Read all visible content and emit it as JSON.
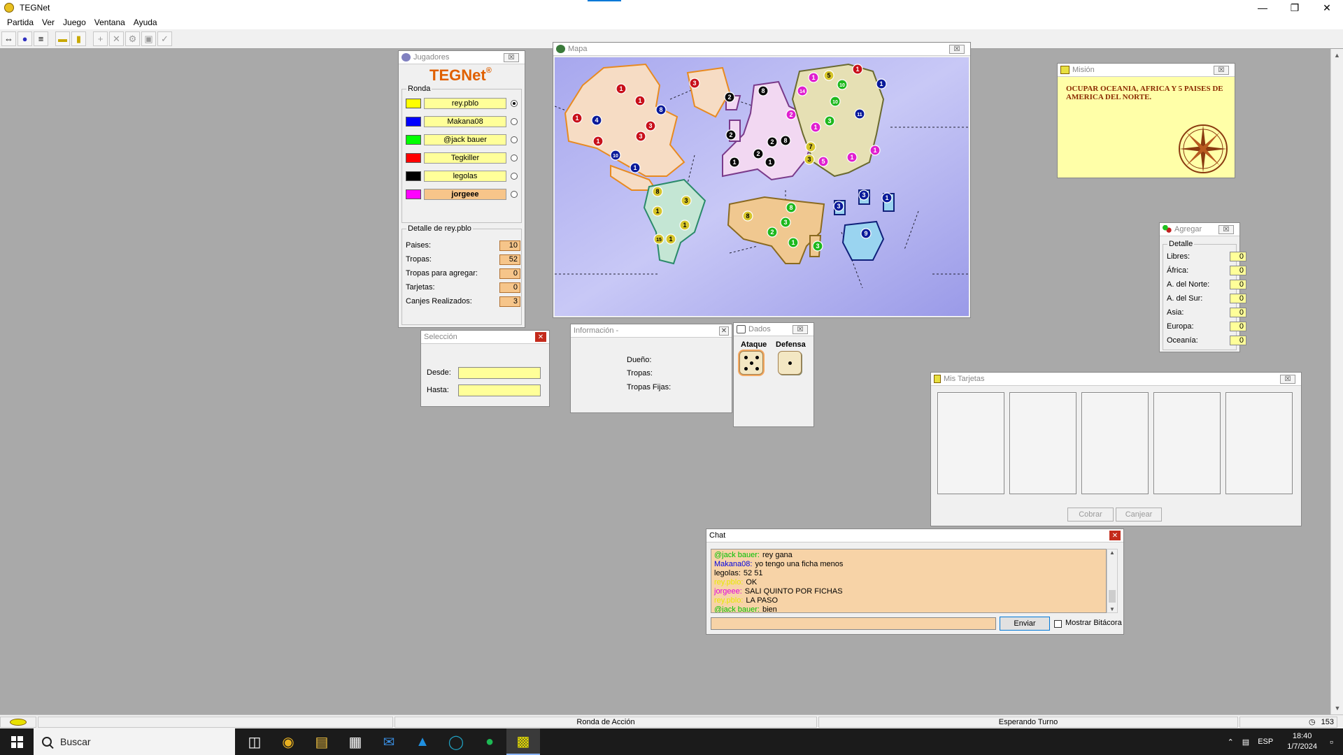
{
  "window": {
    "title": "TEGNet"
  },
  "menu": [
    "Partida",
    "Ver",
    "Juego",
    "Ventana",
    "Ayuda"
  ],
  "toolbar_icons": [
    "connect-icon",
    "server-icon",
    "list-icon",
    "card-icon",
    "note-icon",
    "add-icon",
    "remove-icon",
    "gear-icon",
    "copy-icon",
    "check-icon"
  ],
  "players_window": {
    "title": "Jugadores",
    "logo": "TEGNet",
    "round_label": "Ronda",
    "players": [
      {
        "name": "rey.pblo",
        "color": "#ffff00",
        "selected": true
      },
      {
        "name": "Makana08",
        "color": "#0000ff",
        "selected": false
      },
      {
        "name": "@jack bauer",
        "color": "#00ff00",
        "selected": false
      },
      {
        "name": "Tegkiller",
        "color": "#ff0000",
        "selected": false
      },
      {
        "name": "legolas",
        "color": "#000000",
        "selected": false
      },
      {
        "name": "jorgeee",
        "color": "#ff00ff",
        "selected": false
      }
    ],
    "detail_label": "Detalle de rey.pblo",
    "details": [
      {
        "label": "Paises:",
        "value": "10"
      },
      {
        "label": "Tropas:",
        "value": "52"
      },
      {
        "label": "Tropas para agregar:",
        "value": "0"
      },
      {
        "label": "Tarjetas:",
        "value": "0"
      },
      {
        "label": "Canjes Realizados:",
        "value": "3"
      }
    ]
  },
  "map_window": {
    "title": "Mapa",
    "colors": {
      "yellow": "#d6c52a",
      "blue": "#0a1a9a",
      "green": "#1db81d",
      "red": "#c8101a",
      "black": "#0a0a0a",
      "magenta": "#e020d0"
    },
    "armies": [
      {
        "n": "1",
        "c": "red"
      },
      {
        "n": "4",
        "c": "blue"
      },
      {
        "n": "1",
        "c": "red"
      },
      {
        "n": "3",
        "c": "red"
      },
      {
        "n": "8",
        "c": "blue"
      },
      {
        "n": "1",
        "c": "red"
      },
      {
        "n": "3",
        "c": "red"
      },
      {
        "n": "1",
        "c": "red"
      },
      {
        "n": "10",
        "c": "blue"
      },
      {
        "n": "1",
        "c": "blue"
      },
      {
        "n": "3",
        "c": "red"
      },
      {
        "n": "2",
        "c": "black"
      },
      {
        "n": "8",
        "c": "black"
      },
      {
        "n": "2",
        "c": "magenta"
      },
      {
        "n": "2",
        "c": "black"
      },
      {
        "n": "2",
        "c": "black"
      },
      {
        "n": "8",
        "c": "black"
      },
      {
        "n": "2",
        "c": "black"
      },
      {
        "n": "1",
        "c": "black"
      },
      {
        "n": "1",
        "c": "black"
      },
      {
        "n": "1",
        "c": "magenta"
      },
      {
        "n": "5",
        "c": "yellow"
      },
      {
        "n": "10",
        "c": "green"
      },
      {
        "n": "1",
        "c": "red"
      },
      {
        "n": "14",
        "c": "magenta"
      },
      {
        "n": "10",
        "c": "green"
      },
      {
        "n": "3",
        "c": "green"
      },
      {
        "n": "11",
        "c": "blue"
      },
      {
        "n": "1",
        "c": "blue"
      },
      {
        "n": "1",
        "c": "magenta"
      },
      {
        "n": "7",
        "c": "yellow"
      },
      {
        "n": "3",
        "c": "yellow"
      },
      {
        "n": "5",
        "c": "magenta"
      },
      {
        "n": "1",
        "c": "magenta"
      },
      {
        "n": "1",
        "c": "magenta"
      },
      {
        "n": "8",
        "c": "yellow"
      },
      {
        "n": "3",
        "c": "yellow"
      },
      {
        "n": "1",
        "c": "yellow"
      },
      {
        "n": "1",
        "c": "yellow"
      },
      {
        "n": "15",
        "c": "yellow"
      },
      {
        "n": "1",
        "c": "yellow"
      },
      {
        "n": "8",
        "c": "green"
      },
      {
        "n": "8",
        "c": "yellow"
      },
      {
        "n": "3",
        "c": "green"
      },
      {
        "n": "2",
        "c": "green"
      },
      {
        "n": "1",
        "c": "green"
      },
      {
        "n": "3",
        "c": "green"
      },
      {
        "n": "3",
        "c": "blue"
      },
      {
        "n": "3",
        "c": "blue"
      },
      {
        "n": "1",
        "c": "blue"
      },
      {
        "n": "9",
        "c": "blue"
      }
    ]
  },
  "mission_window": {
    "title": "Misión",
    "text": "OCUPAR OCEANIA, AFRICA Y 5 PAISES DE AMERICA DEL NORTE."
  },
  "add_window": {
    "title": "Agregar",
    "group": "Detalle",
    "rows": [
      {
        "label": "Libres:",
        "value": "0"
      },
      {
        "label": "África:",
        "value": "0"
      },
      {
        "label": "A. del Norte:",
        "value": "0"
      },
      {
        "label": "A. del Sur:",
        "value": "0"
      },
      {
        "label": "Asia:",
        "value": "0"
      },
      {
        "label": "Europa:",
        "value": "0"
      },
      {
        "label": "Oceanía:",
        "value": "0"
      }
    ]
  },
  "selection_window": {
    "title": "Selección",
    "from_label": "Desde:",
    "to_label": "Hasta:",
    "from_value": "",
    "to_value": ""
  },
  "info_window": {
    "title": "Información -",
    "owner_label": "Dueño:",
    "troops_label": "Tropas:",
    "fixed_label": "Tropas Fijas:"
  },
  "dice_window": {
    "title": "Dados",
    "attack_label": "Ataque",
    "defense_label": "Defensa",
    "attack_value": 5,
    "defense_value": 1
  },
  "cards_window": {
    "title": "Mis Tarjetas",
    "collect_label": "Cobrar",
    "exchange_label": "Canjear"
  },
  "chat_window": {
    "title": "Chat",
    "messages": [
      {
        "name": "@jack bauer:",
        "text": "rey gana",
        "color": "#00c000"
      },
      {
        "name": "Makana08:",
        "text": "yo tengo una ficha menos",
        "color": "#0000e0"
      },
      {
        "name": "legolas:",
        "text": "52 51",
        "color": "#000000"
      },
      {
        "name": "rey.pblo:",
        "text": "OK",
        "color": "#e8e800"
      },
      {
        "name": "jorgeee:",
        "text": "SALI QUINTO POR FICHAS",
        "color": "#e000e0"
      },
      {
        "name": "rey.pblo:",
        "text": "LA PASO",
        "color": "#e8e800"
      },
      {
        "name": "@jack bauer:",
        "text": "bien",
        "color": "#00c000"
      }
    ],
    "input_value": "",
    "send_label": "Enviar",
    "log_label": "Mostrar Bitácora"
  },
  "status": {
    "phase": "Ronda de Acción",
    "turn": "Esperando Turno",
    "count": "153"
  },
  "taskbar": {
    "search_placeholder": "Buscar",
    "lang": "ESP",
    "time": "18:40",
    "date": "1/7/2024",
    "apps": [
      "task-view-icon",
      "chrome-icon",
      "file-explorer-icon",
      "store-icon",
      "mail-icon",
      "app-icon",
      "edge-icon",
      "spotify-icon",
      "tegnet-icon"
    ]
  }
}
